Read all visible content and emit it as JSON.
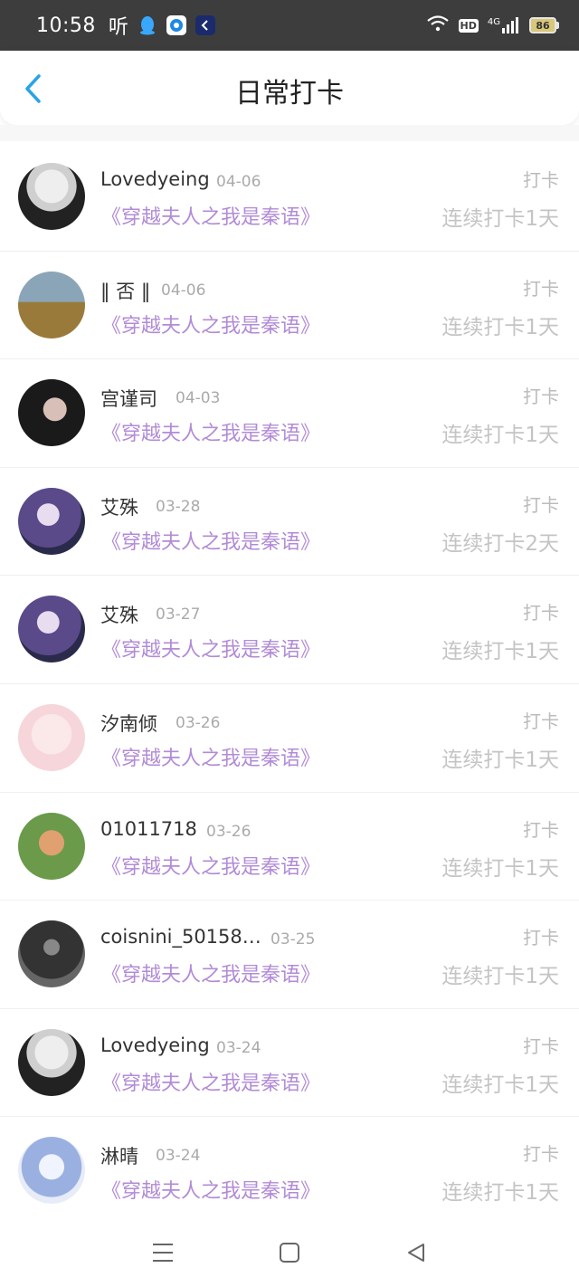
{
  "status_bar": {
    "time": "10:58",
    "app_ting": "听",
    "network": "4G",
    "hd": "HD",
    "battery": "86"
  },
  "header": {
    "title": "日常打卡",
    "back_icon": "chevron-left-icon",
    "accent_color": "#2aa3e6"
  },
  "colors": {
    "book_title": "#b28bd6",
    "date": "#aaaaaa",
    "streak": "#c4c4c4"
  },
  "rows": [
    {
      "name": "Lovedyeing",
      "date": "04-06",
      "book": "《穿越夫人之我是秦语》",
      "label": "打卡",
      "streak": "连续打卡1天",
      "avatar": "avatar-girl-white-hair"
    },
    {
      "name": "‖ 否 ‖",
      "date": "04-06",
      "book": "《穿越夫人之我是秦语》",
      "label": "打卡",
      "streak": "连续打卡1天",
      "avatar": "avatar-field"
    },
    {
      "name": "宫谨司",
      "date": "04-03",
      "book": "《穿越夫人之我是秦语》",
      "label": "打卡",
      "streak": "连续打卡1天",
      "avatar": "avatar-dark-hair"
    },
    {
      "name": "艾殊",
      "date": "03-28",
      "book": "《穿越夫人之我是秦语》",
      "label": "打卡",
      "streak": "连续打卡2天",
      "avatar": "avatar-anime-purple"
    },
    {
      "name": "艾殊",
      "date": "03-27",
      "book": "《穿越夫人之我是秦语》",
      "label": "打卡",
      "streak": "连续打卡1天",
      "avatar": "avatar-anime-purple"
    },
    {
      "name": "汐南倾",
      "date": "03-26",
      "book": "《穿越夫人之我是秦语》",
      "label": "打卡",
      "streak": "连续打卡1天",
      "avatar": "avatar-pastel"
    },
    {
      "name": "01011718",
      "date": "03-26",
      "book": "《穿越夫人之我是秦语》",
      "label": "打卡",
      "streak": "连续打卡1天",
      "avatar": "avatar-cartoon"
    },
    {
      "name": "coisnini_50158…",
      "date": "03-25",
      "book": "《穿越夫人之我是秦语》",
      "label": "打卡",
      "streak": "连续打卡1天",
      "avatar": "avatar-photo-dark"
    },
    {
      "name": "Lovedyeing",
      "date": "03-24",
      "book": "《穿越夫人之我是秦语》",
      "label": "打卡",
      "streak": "连续打卡1天",
      "avatar": "avatar-girl-white-hair"
    },
    {
      "name": "淋晴",
      "date": "03-24",
      "book": "《穿越夫人之我是秦语》",
      "label": "打卡",
      "streak": "连续打卡1天",
      "avatar": "avatar-anime-blue"
    }
  ],
  "nav": {
    "menu_icon": "menu-icon",
    "home_icon": "home-square-icon",
    "back_icon": "back-triangle-icon"
  }
}
